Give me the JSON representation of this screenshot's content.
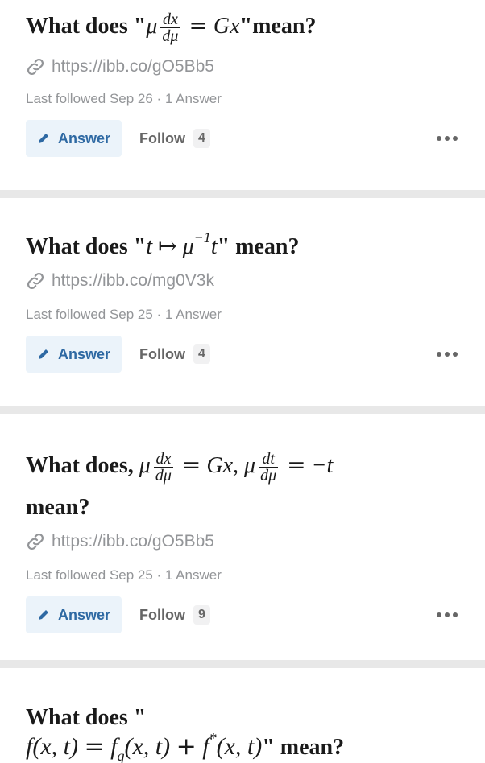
{
  "questions": [
    {
      "title_prefix": "What does \"",
      "title_suffix": "\"mean?",
      "link": "https://ibb.co/gO5Bb5",
      "meta": "Last followed Sep 26 · 1 Answer",
      "answer_label": "Answer",
      "follow_label": "Follow",
      "follow_count": "4"
    },
    {
      "title_prefix": "What does \"",
      "title_suffix": "\" mean?",
      "link": "https://ibb.co/mg0V3k",
      "meta": "Last followed Sep 25 · 1 Answer",
      "answer_label": "Answer",
      "follow_label": "Follow",
      "follow_count": "4"
    },
    {
      "title_prefix": "What does, ",
      "title_suffix": "mean?",
      "link": "https://ibb.co/gO5Bb5",
      "meta": "Last followed Sep 25 · 1 Answer",
      "answer_label": "Answer",
      "follow_label": "Follow",
      "follow_count": "9"
    },
    {
      "title_prefix": "What does \"",
      "title_suffix": "\" mean?"
    }
  ],
  "icons": {
    "link": "link-icon",
    "pencil": "pencil-icon",
    "more": "more-options-icon"
  },
  "colors": {
    "accent": "#2e69a3",
    "accent_bg": "#ebf3fa",
    "muted": "#939598",
    "divider": "#e8e8e8"
  }
}
